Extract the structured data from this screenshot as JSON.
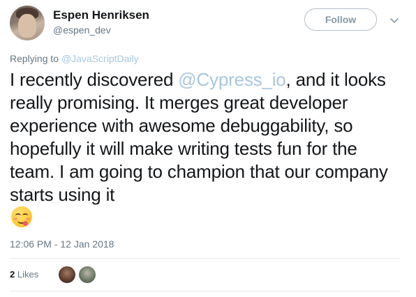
{
  "author": {
    "name": "Espen Henriksen",
    "handle": "@espen_dev"
  },
  "follow_button_label": "Follow",
  "reply": {
    "prefix": "Replying to",
    "target": "@JavaScriptDaily"
  },
  "tweet": {
    "text_before_mention": "I recently discovered ",
    "mention": "@Cypress_io",
    "text_after_mention": ", and it looks really promising. It merges great developer experience with awesome debuggability, so hopefully it will make writing tests fun for the team. I am going to champion that our company starts using it",
    "emoji": "savoring-food-face-emoji"
  },
  "timestamp": "12:06 PM - 12 Jan 2018",
  "likes": {
    "count": "2",
    "label": "Likes"
  },
  "colors": {
    "link": "#a8c6e0",
    "secondary_text": "#657786",
    "primary_text": "#14171a",
    "border": "#e6ecf0"
  },
  "icons": {
    "caret": "chevron-down-icon"
  }
}
